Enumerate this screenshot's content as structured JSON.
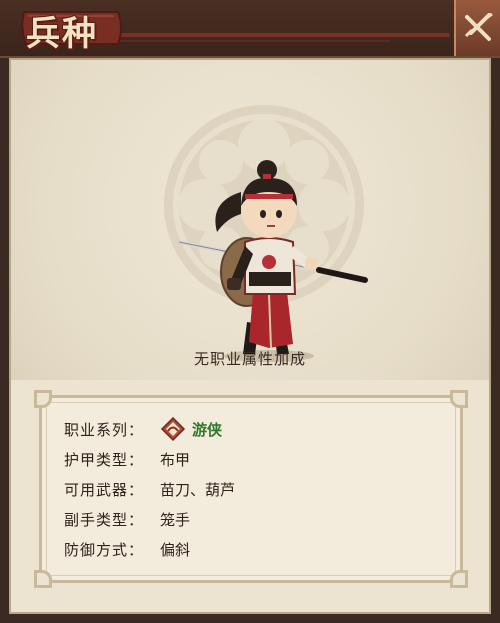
{
  "header": {
    "title": "兵种",
    "close_icon": "close-swords-icon"
  },
  "character": {
    "name_icon": "swordsman-character-portrait"
  },
  "bonus_text": "无职业属性加成",
  "info": {
    "rows": [
      {
        "label": "职业系列：",
        "value": "游侠",
        "icon": "ranger-class-icon",
        "value_color": "#2f7a2a"
      },
      {
        "label": "护甲类型：",
        "value": "布甲"
      },
      {
        "label": "可用武器：",
        "value": "苗刀、葫芦"
      },
      {
        "label": "副手类型：",
        "value": "笼手"
      },
      {
        "label": "防御方式：",
        "value": "偏斜"
      }
    ]
  }
}
